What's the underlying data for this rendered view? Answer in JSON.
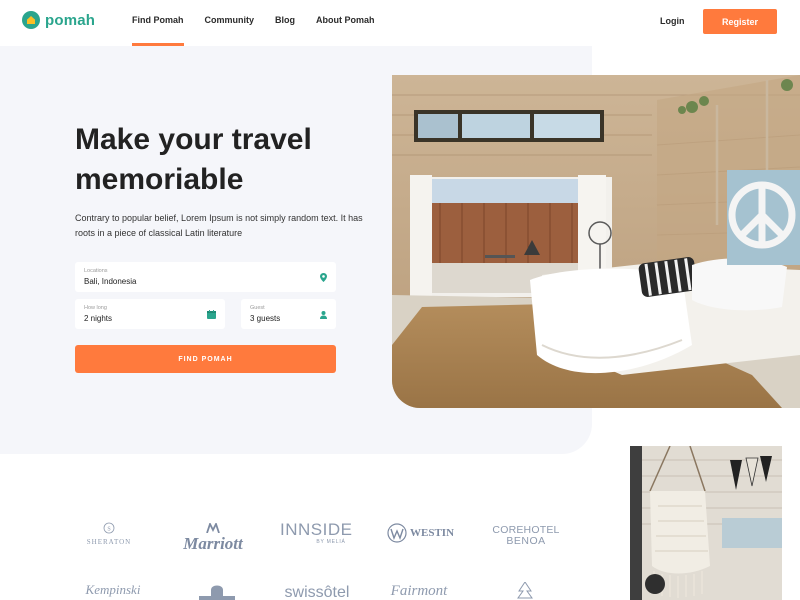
{
  "header": {
    "logo_text": "pomah",
    "nav": [
      {
        "label": "Find Pomah",
        "active": true
      },
      {
        "label": "Community",
        "active": false
      },
      {
        "label": "Blog",
        "active": false
      },
      {
        "label": "About Pomah",
        "active": false
      }
    ],
    "login_label": "Login",
    "register_label": "Register"
  },
  "hero": {
    "title": "Make your travel memoriable",
    "description": "Contrary to popular belief, Lorem Ipsum is not simply random text. It has roots in a piece of classical Latin literature",
    "search": {
      "location": {
        "label": "Locations",
        "value": "Bali, Indonesia",
        "icon": "map-pin-icon"
      },
      "how_long": {
        "label": "How long",
        "value": "2 nights",
        "icon": "calendar-icon"
      },
      "guest": {
        "label": "Guest",
        "value": "3 guests",
        "icon": "user-icon"
      },
      "button_label": "FIND POMAH"
    }
  },
  "brands": {
    "row1": [
      "SHERATON",
      "Marriott",
      "INNSIDE",
      "BY MELIÁ",
      "WESTIN",
      "COREHOTEL",
      "BENOA"
    ],
    "row2": [
      "Kempinski",
      "swissôtel",
      "Fairmont"
    ]
  },
  "colors": {
    "accent": "#ff7a3d",
    "brand": "#2aa58d",
    "hero_bg": "#f5f6fa",
    "logo_gray": "#8e9aae"
  }
}
